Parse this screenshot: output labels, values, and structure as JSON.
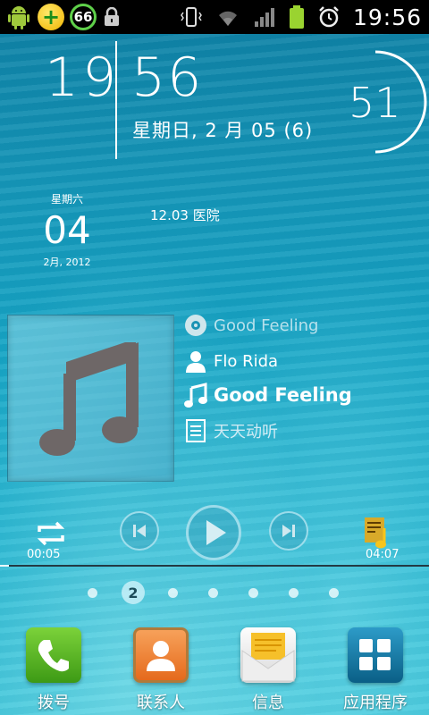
{
  "status_bar": {
    "badge_count": "66",
    "time": "19:56",
    "icons": [
      "android-debug-icon",
      "plus-icon",
      "cleaner-badge-icon",
      "lock-icon",
      "vibrate-icon",
      "wifi-icon",
      "signal-icon",
      "battery-icon",
      "alarm-icon"
    ]
  },
  "clock": {
    "hour": "19",
    "minute": "56",
    "date": "星期日, 2 月 05 (6)",
    "seconds": "51"
  },
  "calendar": {
    "weekday": "星期六",
    "day": "04",
    "month_year": "2月, 2012",
    "event": "12.03 医院"
  },
  "music": {
    "album": "Good Feeling",
    "artist": "Flo Rida",
    "title": "Good Feeling",
    "source": "天天动听",
    "elapsed": "00:05",
    "duration": "04:07",
    "progress": 0.02,
    "accent": "#e8f8fc"
  },
  "pager": {
    "current": "2",
    "total_dots": 7
  },
  "dock": [
    {
      "label": "拨号",
      "icon": "phone-icon"
    },
    {
      "label": "联系人",
      "icon": "contacts-icon"
    },
    {
      "label": "信息",
      "icon": "messages-icon"
    },
    {
      "label": "应用程序",
      "icon": "app-drawer-icon"
    }
  ]
}
